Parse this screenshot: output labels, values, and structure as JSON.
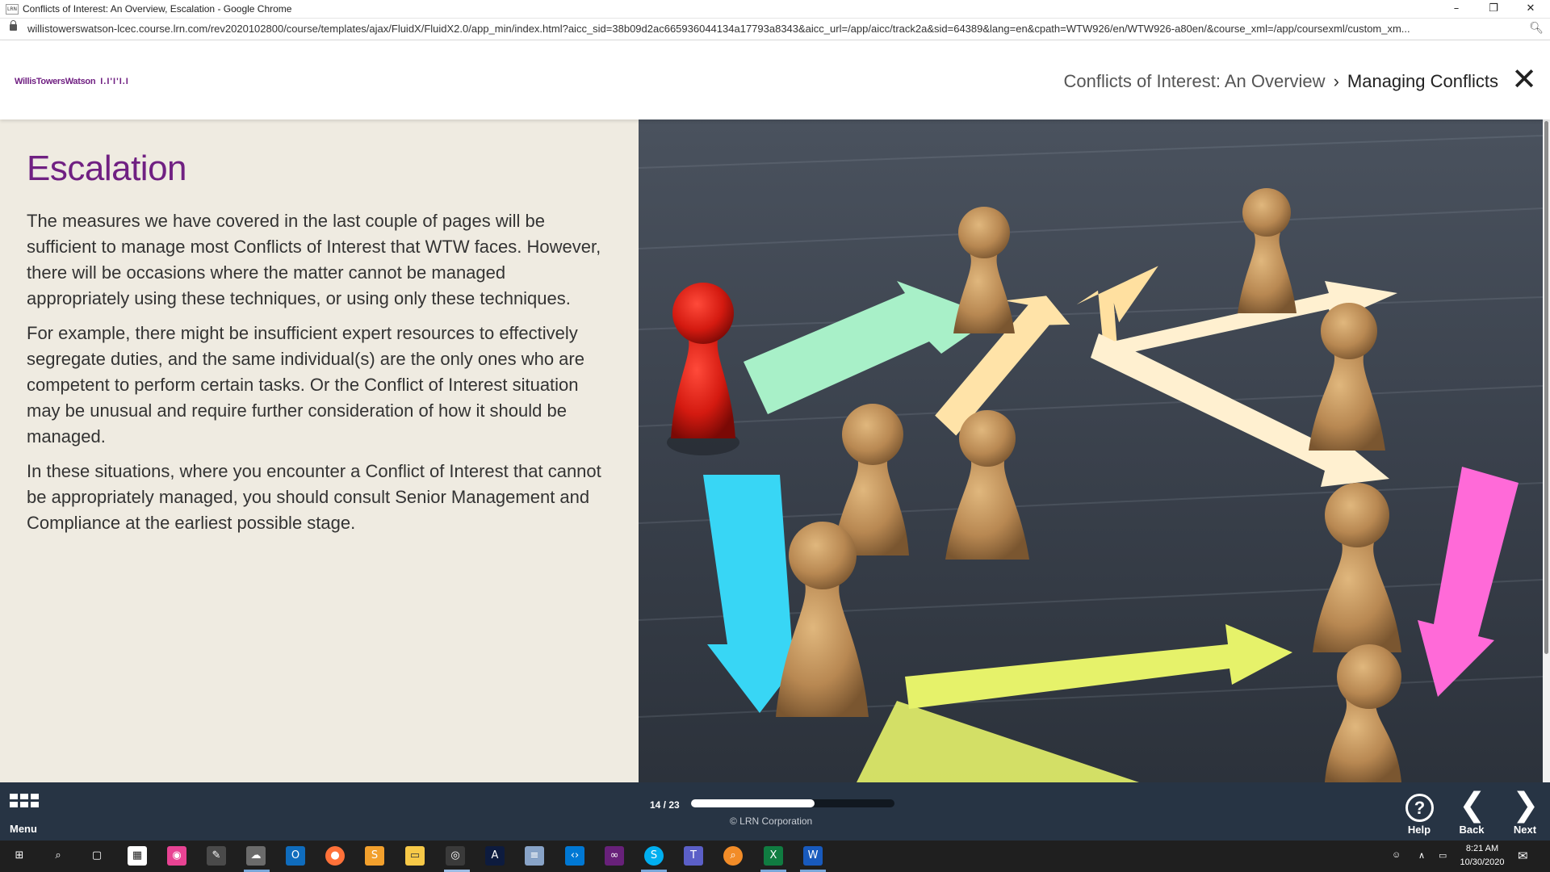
{
  "browser": {
    "favicon_text": "LRN",
    "window_title": "Conflicts of Interest: An Overview, Escalation - Google Chrome",
    "url": "willistowerswatson-lcec.course.lrn.com/rev2020102800/course/templates/ajax/FluidX/FluidX2.0/app_min/index.html?aicc_sid=38b09d2ac665936044134a17793a8343&aicc_url=/app/aicc/track2a&sid=64389&lang=en&cpath=WTW926/en/WTW926-a80en/&course_xml=/app/coursexml/custom_xm...",
    "controls": {
      "minimize": "–",
      "restore": "❐",
      "close": "✕"
    }
  },
  "header": {
    "logo_text": "WillisTowersWatson",
    "logo_mark": "I.I'I'I.I",
    "breadcrumb": {
      "course": "Conflicts of Interest: An Overview",
      "separator": "›",
      "section": "Managing Conflicts"
    },
    "close_glyph": "✕"
  },
  "page": {
    "title": "Escalation",
    "paragraphs": [
      "The measures we have covered in the last couple of pages will be sufficient to manage most Conflicts of Interest that WTW faces. However, there will be occasions where the matter cannot be managed appropriately using these techniques, or using only these techniques.",
      "For example, there might be insufficient expert resources to effectively segregate duties, and the same individual(s) are the only ones who are competent to perform certain tasks. Or the Conflict of Interest situation may be unusual and require further consideration of how it should be managed.",
      "In these situations, where you encounter a Conflict of Interest that cannot be appropriately managed, you should consult Senior Management and Compliance at the earliest possible stage."
    ]
  },
  "footer": {
    "menu_label": "Menu",
    "page_indicator": "14 / 23",
    "progress_fraction": 0.6087,
    "copyright": "© LRN Corporation",
    "help_label": "Help",
    "back_label": "Back",
    "next_label": "Next",
    "help_glyph": "?",
    "back_glyph": "❮",
    "next_glyph": "❯"
  },
  "taskbar": {
    "clock_time": "8:21 AM",
    "clock_date": "10/30/2020"
  },
  "colors": {
    "accent_purple": "#702082",
    "content_bg": "#efebe1",
    "footer_bg": "#273444"
  }
}
